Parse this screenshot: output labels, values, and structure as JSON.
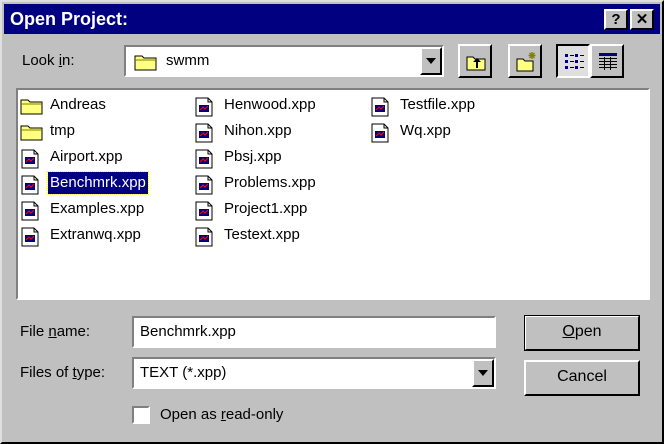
{
  "window": {
    "title": "Open Project:",
    "help_label": "?",
    "close_label": "✕"
  },
  "look_in": {
    "label_pre": "Look ",
    "label_key": "i",
    "label_post": "n:",
    "value": "swmm"
  },
  "toolbar": {
    "up_folder_icon": "up-folder-icon",
    "new_folder_icon": "new-folder-icon",
    "list_view_icon": "list-view-icon",
    "details_view_icon": "details-view-icon"
  },
  "files": {
    "col1": [
      {
        "name": "Andreas",
        "type": "folder"
      },
      {
        "name": "tmp",
        "type": "folder"
      },
      {
        "name": "Airport.xpp",
        "type": "file"
      },
      {
        "name": "Benchmrk.xpp",
        "type": "file"
      },
      {
        "name": "Examples.xpp",
        "type": "file"
      },
      {
        "name": "Extranwq.xpp",
        "type": "file"
      }
    ],
    "col2": [
      {
        "name": "Henwood.xpp",
        "type": "file"
      },
      {
        "name": "Nihon.xpp",
        "type": "file"
      },
      {
        "name": "Pbsj.xpp",
        "type": "file"
      },
      {
        "name": "Problems.xpp",
        "type": "file"
      },
      {
        "name": "Project1.xpp",
        "type": "file"
      },
      {
        "name": "Testext.xpp",
        "type": "file"
      }
    ],
    "col3": [
      {
        "name": "Testfile.xpp",
        "type": "file"
      },
      {
        "name": "Wq.xpp",
        "type": "file"
      }
    ],
    "selected": "Benchmrk.xpp"
  },
  "file_name": {
    "label_pre": "File ",
    "label_key": "n",
    "label_post": "ame:",
    "value": "Benchmrk.xpp"
  },
  "file_type": {
    "label_pre": "Files of ",
    "label_key": "t",
    "label_post": "ype:",
    "value": "TEXT (*.xpp)"
  },
  "buttons": {
    "open_key": "O",
    "open_rest": "pen",
    "cancel": "Cancel"
  },
  "read_only": {
    "label_pre": "Open as ",
    "label_key": "r",
    "label_post": "ead-only",
    "checked": false
  },
  "colors": {
    "title_bar": "#000080",
    "face": "#c0c0c0",
    "selection": "#000080"
  }
}
